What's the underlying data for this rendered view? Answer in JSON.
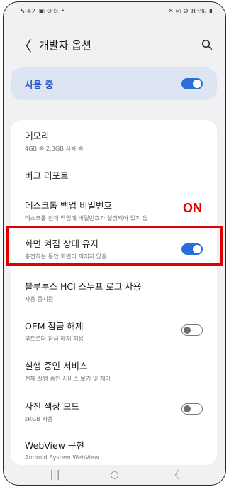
{
  "status": {
    "time": "5:42",
    "left_icons": "▣ ⊙ ▷ •",
    "right_icons": "✕ ◎ ⊘",
    "battery": "83%"
  },
  "header": {
    "back_icon": "chevron-left-icon",
    "title": "개발자 옵션",
    "search_icon": "search-icon"
  },
  "master": {
    "label": "사용 중",
    "toggle_on": true
  },
  "items": [
    {
      "title": "메모리",
      "subtitle": "4GB 중 2.3GB 사용 중"
    },
    {
      "title": "버그 리포트",
      "subtitle": ""
    },
    {
      "title": "데스크톱 백업 비밀번호",
      "subtitle": "데스크톱 전체 백업에 비밀번호가 설정되어 있지 않"
    },
    {
      "title": "화면 켜짐 상태 유지",
      "subtitle": "충전하는 동안 화면이 꺼지지 않음",
      "toggle": "on"
    },
    {
      "title": "블루투스 HCI 스누프 로그 사용",
      "subtitle": "사용 중지됨"
    },
    {
      "title": "OEM 잠금 해제",
      "subtitle": "부트로더 잠금 해제 허용",
      "toggle": "off"
    },
    {
      "title": "실행 중인 서비스",
      "subtitle": "현재 실행 중인 서비스 보기 및 제어"
    },
    {
      "title": "사진 색상 모드",
      "subtitle": "sRGB 사용",
      "toggle": "off"
    },
    {
      "title": "WebView 구현",
      "subtitle": "Android System WebView"
    }
  ],
  "annotation": {
    "text": "ON",
    "color": "#e00000"
  },
  "nav": {
    "recents": "|||",
    "home": "○",
    "back": "〈"
  },
  "colors": {
    "accent": "#2a6fd6",
    "master_bg": "#dde5f2",
    "highlight": "#e00000"
  }
}
